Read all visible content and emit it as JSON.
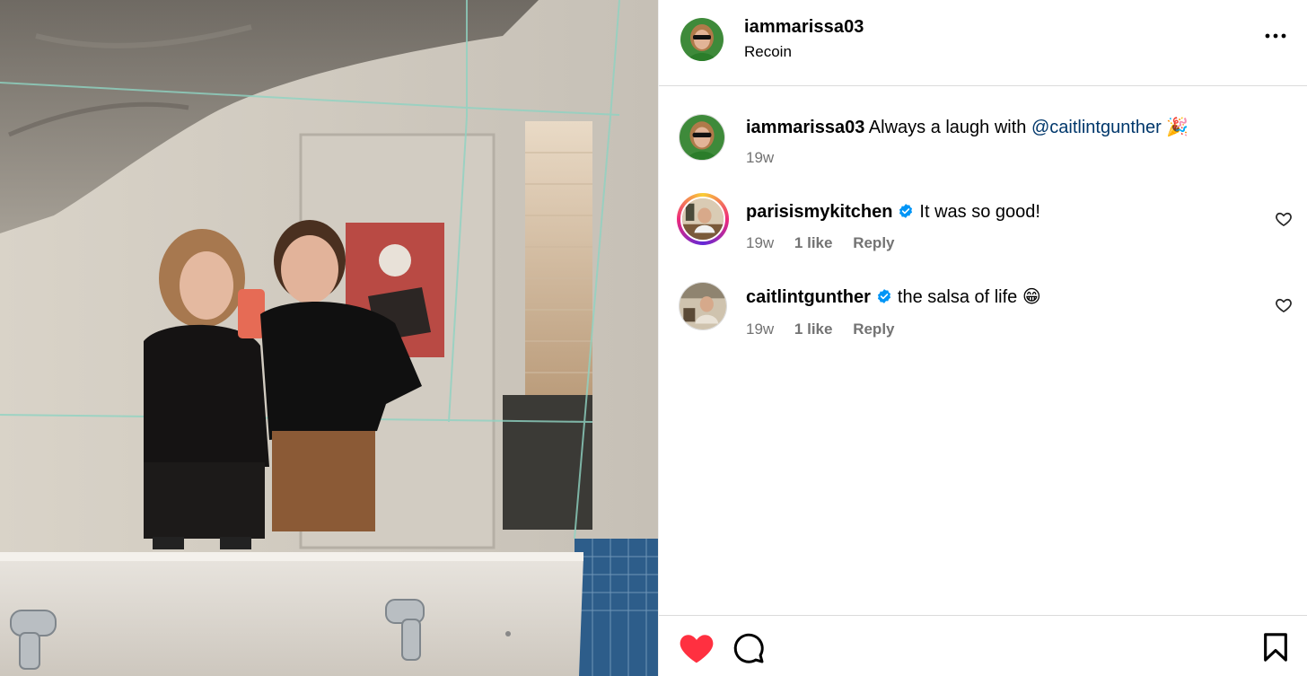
{
  "post": {
    "username": "iammarissa03",
    "location": "Recoin"
  },
  "caption": {
    "username": "iammarissa03",
    "text": "Always a laugh with ",
    "mention": "@caitlintgunther",
    "emoji": "🎉",
    "time": "19w"
  },
  "comments": [
    {
      "username": "parisismykitchen",
      "verified": true,
      "text": "It was so good!",
      "time": "19w",
      "likes": "1 like",
      "reply": "Reply"
    },
    {
      "username": "caitlintgunther",
      "verified": true,
      "text": "the salsa of life 😁",
      "time": "19w",
      "likes": "1 like",
      "reply": "Reply"
    }
  ],
  "icons": {
    "more": "more-options-icon",
    "like": "heart-filled-icon",
    "comment": "comment-bubble-icon",
    "save": "bookmark-icon",
    "verified": "verified-badge-icon",
    "comment_like": "heart-outline-icon"
  },
  "colors": {
    "like_red": "#ff3040",
    "verified_blue": "#0095f6",
    "mention_blue": "#00376b",
    "meta_gray": "#737373",
    "divider": "#dbdbdb"
  },
  "state": {
    "post_liked": true
  }
}
